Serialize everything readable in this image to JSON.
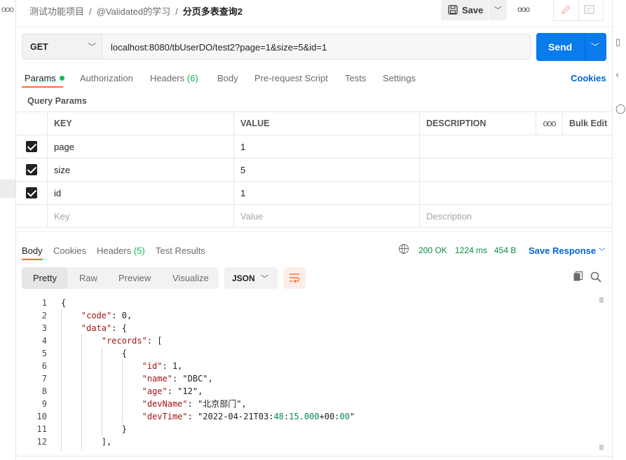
{
  "breadcrumb": {
    "collection": "测试功能项目",
    "folder": "@Validated的学习",
    "request": "分页多表查询2"
  },
  "header": {
    "save_label": "Save",
    "more_label": "ooo"
  },
  "request": {
    "method": "GET",
    "url": "localhost:8080/tbUserDO/test2?page=1&size=5&id=1",
    "send_label": "Send"
  },
  "tabs": [
    {
      "label": "Params"
    },
    {
      "label": "Authorization"
    },
    {
      "label": "Headers",
      "count": "(6)"
    },
    {
      "label": "Body"
    },
    {
      "label": "Pre-request Script"
    },
    {
      "label": "Tests"
    },
    {
      "label": "Settings"
    }
  ],
  "cookies_label": "Cookies",
  "query_params": {
    "title": "Query Params",
    "columns": {
      "key": "KEY",
      "value": "VALUE",
      "description": "DESCRIPTION",
      "more": "ooo",
      "bulk_edit": "Bulk Edit"
    },
    "rows": [
      {
        "key": "page",
        "value": "1",
        "description": ""
      },
      {
        "key": "size",
        "value": "5",
        "description": ""
      },
      {
        "key": "id",
        "value": "1",
        "description": ""
      }
    ],
    "placeholder": {
      "key": "Key",
      "value": "Value",
      "description": "Description"
    }
  },
  "response": {
    "tabs": [
      {
        "label": "Body"
      },
      {
        "label": "Cookies"
      },
      {
        "label": "Headers",
        "count": "(5)"
      },
      {
        "label": "Test Results"
      }
    ],
    "status": "200 OK",
    "time": "1224 ms",
    "size": "454 B",
    "save_label": "Save Response",
    "views": [
      "Pretty",
      "Raw",
      "Preview",
      "Visualize"
    ],
    "format": "JSON"
  },
  "code_lines": [
    {
      "n": "1",
      "t": "{"
    },
    {
      "n": "2",
      "t": "    \"code\": 0,"
    },
    {
      "n": "3",
      "t": "    \"data\": {"
    },
    {
      "n": "4",
      "t": "        \"records\": ["
    },
    {
      "n": "5",
      "t": "            {"
    },
    {
      "n": "6",
      "t": "                \"id\": 1,"
    },
    {
      "n": "7",
      "t": "                \"name\": \"DBC\","
    },
    {
      "n": "8",
      "t": "                \"age\": \"12\","
    },
    {
      "n": "9",
      "t": "                \"devName\": \"北京部门\","
    },
    {
      "n": "10",
      "t": "                \"devTime\": \"2022-04-21T03:48:15.000+00:00\""
    },
    {
      "n": "11",
      "t": "            }"
    },
    {
      "n": "12",
      "t": "        ],"
    }
  ]
}
